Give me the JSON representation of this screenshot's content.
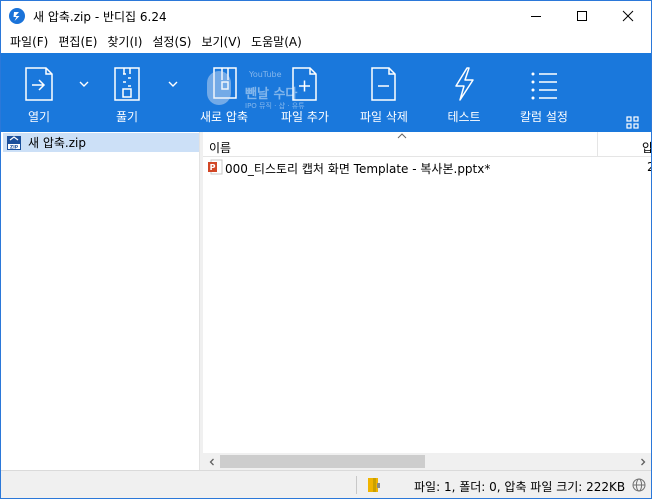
{
  "window": {
    "title": "새 압축.zip - 반디집 6.24"
  },
  "menu": {
    "items": [
      {
        "label": "파일(F)"
      },
      {
        "label": "편집(E)"
      },
      {
        "label": "찾기(I)"
      },
      {
        "label": "설정(S)"
      },
      {
        "label": "보기(V)"
      },
      {
        "label": "도움말(A)"
      }
    ]
  },
  "toolbar": {
    "background": "#1a78dc",
    "buttons": [
      {
        "label": "열기",
        "icon": "open-archive-icon",
        "has_dropdown": true
      },
      {
        "label": "풀기",
        "icon": "extract-icon",
        "has_dropdown": true
      },
      {
        "label": "새로 압축",
        "icon": "new-archive-icon",
        "has_dropdown": false
      },
      {
        "label": "파일 추가",
        "icon": "add-file-icon",
        "has_dropdown": false
      },
      {
        "label": "파일 삭제",
        "icon": "delete-file-icon",
        "has_dropdown": false
      },
      {
        "label": "테스트",
        "icon": "test-lightning-icon",
        "has_dropdown": false
      },
      {
        "label": "칼럼 설정",
        "icon": "column-settings-icon",
        "has_dropdown": false
      }
    ]
  },
  "watermark": {
    "badge_text": "YouTube",
    "name": "뺀날 수다",
    "sub": "IPO 뮤직 · 샵 · 유튜"
  },
  "tree": {
    "root_label": "새 압축.zip",
    "selected": true
  },
  "filelist": {
    "columns": [
      {
        "label": "이름",
        "sorted": "ascending"
      },
      {
        "label": "압"
      }
    ],
    "rows": [
      {
        "name": "000_티스토리 캡처 화면 Template - 복사본.pptx*",
        "col2": "2",
        "icon": "pptx-file-icon"
      }
    ]
  },
  "status": {
    "text": "파일: 1, 폴더: 0, 압축 파일 크기: 222KB"
  },
  "colors": {
    "accent": "#1a78dc",
    "selection": "#cce0f7",
    "pptx": "#d24726",
    "lock": "#f0b400"
  }
}
